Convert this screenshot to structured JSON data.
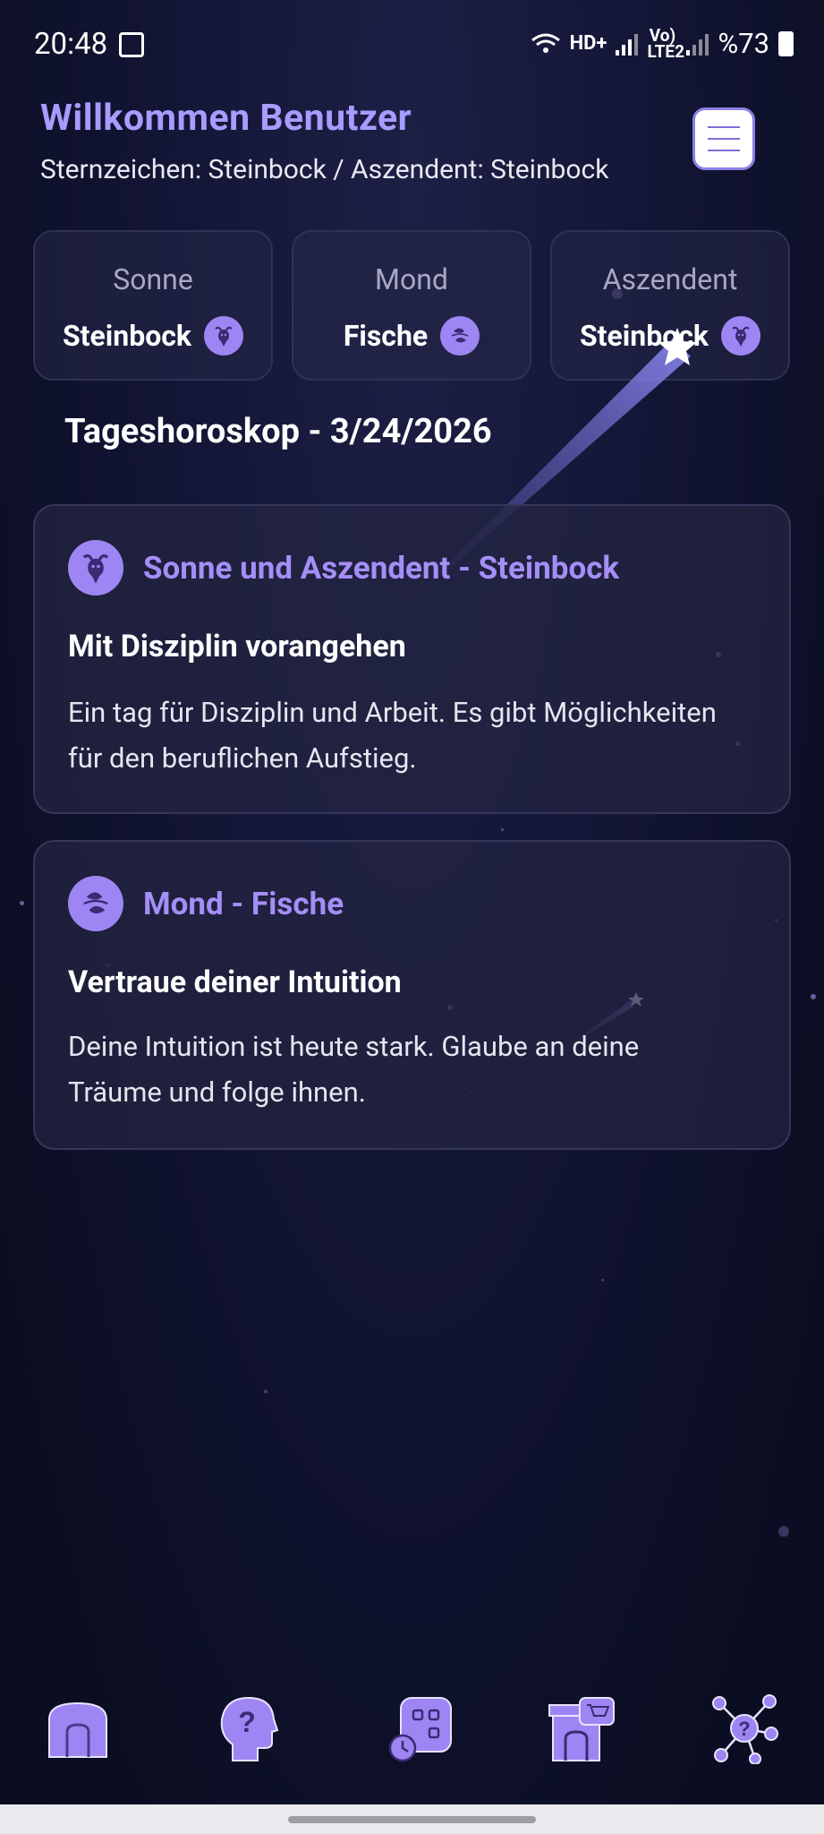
{
  "status_bar": {
    "time": "20:48",
    "network_label": "HD+",
    "lte_label": "Vo) LTE2",
    "battery": "%73"
  },
  "header": {
    "title": "Willkommen Benutzer",
    "subtitle": "Sternzeichen: Steinbock / Aszendent: Steinbock"
  },
  "signs": [
    {
      "label": "Sonne",
      "value": "Steinbock",
      "icon": "capricorn-icon"
    },
    {
      "label": "Mond",
      "value": "Fische",
      "icon": "pisces-icon"
    },
    {
      "label": "Aszendent",
      "value": "Steinbock",
      "icon": "capricorn-icon"
    }
  ],
  "daily": {
    "title": "Tageshoroskop - 3/24/2026"
  },
  "horoscopes": [
    {
      "title": "Sonne und Aszendent - Steinbock",
      "headline": "Mit Disziplin vorangehen",
      "text": "Ein tag für Disziplin und Arbeit. Es gibt Möglichkeiten für den beruflichen Aufstieg.",
      "icon": "capricorn-icon"
    },
    {
      "title": "Mond - Fische",
      "headline": "Vertraue deiner Intuition",
      "text": "Deine Intuition ist heute stark. Glaube an deine Träume und folge ihnen.",
      "icon": "pisces-icon"
    }
  ],
  "bottom_nav": [
    {
      "name": "nav-home",
      "icon": "home-icon"
    },
    {
      "name": "nav-ask",
      "icon": "head-question-icon"
    },
    {
      "name": "nav-apps",
      "icon": "grid-clock-icon"
    },
    {
      "name": "nav-shop",
      "icon": "shop-icon"
    },
    {
      "name": "nav-network",
      "icon": "network-question-icon"
    }
  ],
  "colors": {
    "accent": "#a79cff",
    "icon_purple": "#9d86f3",
    "background": "#131636"
  }
}
